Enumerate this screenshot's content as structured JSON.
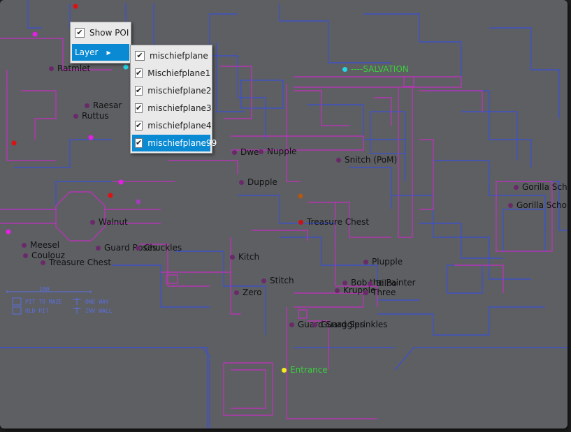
{
  "poi_menu": {
    "show_poi_label": "Show POI",
    "show_poi_checked": true,
    "layer_label": "Layer",
    "layer_arrow_icon": "triangle-right-icon"
  },
  "layers": [
    {
      "label": "mischiefplane",
      "checked": true
    },
    {
      "label": "Mischiefplane1",
      "checked": true
    },
    {
      "label": "mischiefplane2",
      "checked": true
    },
    {
      "label": "mischiefplane3",
      "checked": true
    },
    {
      "label": "mischiefplane4",
      "checked": true
    },
    {
      "label": "mischiefplane99",
      "checked": true,
      "selected": true
    }
  ],
  "pois": [
    {
      "label": "Ratmlet",
      "color": "#6a2a6a",
      "text_color": "#111111"
    },
    {
      "label": "Raesar",
      "color": "#6a2a6a",
      "text_color": "#111111"
    },
    {
      "label": "Ruttus",
      "color": "#6a2a6a",
      "text_color": "#111111"
    },
    {
      "label": "Walnut",
      "color": "#6a2a6a",
      "text_color": "#111111"
    },
    {
      "label": "Meesel",
      "color": "#6a2a6a",
      "text_color": "#111111"
    },
    {
      "label": "Coulouz",
      "color": "#6a2a6a",
      "text_color": "#111111"
    },
    {
      "label": "Treasure Chest",
      "color": "#6a2a6a",
      "text_color": "#111111"
    },
    {
      "label": "Guard Roses",
      "color": "#6a2a6a",
      "text_color": "#111111"
    },
    {
      "label": "Chuckles",
      "color": "#6a2a6a",
      "text_color": "#111111"
    },
    {
      "label": "Dwe",
      "color": "#6a2a6a",
      "text_color": "#111111"
    },
    {
      "label": "Nupple",
      "color": "#6a2a6a",
      "text_color": "#111111"
    },
    {
      "label": "Snitch (PoM)",
      "color": "#6a2a6a",
      "text_color": "#111111"
    },
    {
      "label": "Dupple",
      "color": "#6a2a6a",
      "text_color": "#111111"
    },
    {
      "label": "Treasure Chest",
      "color": "#cc1111",
      "text_color": "#111111"
    },
    {
      "label": "Kitch",
      "color": "#6a2a6a",
      "text_color": "#111111"
    },
    {
      "label": "Stitch",
      "color": "#6a2a6a",
      "text_color": "#111111"
    },
    {
      "label": "Zero",
      "color": "#6a2a6a",
      "text_color": "#111111"
    },
    {
      "label": "Plupple",
      "color": "#6a2a6a",
      "text_color": "#111111"
    },
    {
      "label": "Bob the Painter",
      "color": "#6a2a6a",
      "text_color": "#111111"
    },
    {
      "label": "Krupple",
      "color": "#6a2a6a",
      "text_color": "#111111"
    },
    {
      "label": "Bilbo",
      "color": "#6a2a6a",
      "text_color": "#111111"
    },
    {
      "label": "Three",
      "color": "#6a2a6a",
      "text_color": "#111111"
    },
    {
      "label": "Guard Snaggles",
      "color": "#6a2a6a",
      "text_color": "#111111"
    },
    {
      "label": "Guard Sprinkles",
      "color": "#6a2a6a",
      "text_color": "#111111"
    },
    {
      "label": "Gorilla Scho",
      "color": "#6a2a6a",
      "text_color": "#111111"
    },
    {
      "label": "Gorilla Scho",
      "color": "#6a2a6a",
      "text_color": "#111111"
    },
    {
      "label": "----SALVATION",
      "color": "#22d6e8",
      "text_color": "#3ccf3c"
    },
    {
      "label": "Entrance",
      "color": "#f2ec1a",
      "text_color": "#3ccf3c"
    }
  ],
  "map_legend": {
    "scale": "100",
    "pit_to_maze": "PIT TO MAZE",
    "old_pit": "OLD PIT",
    "one_way": "ONE WAY",
    "inv_wall": "INV WALL"
  },
  "colors": {
    "background": "#5d5f63",
    "wall_blue": "#3a4fd6",
    "wall_magenta": "#c52ec2",
    "highlight": "#0a8ad3"
  }
}
